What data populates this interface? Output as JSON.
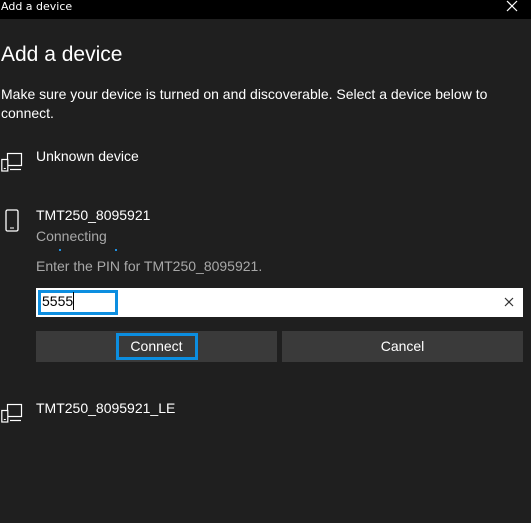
{
  "window": {
    "title": "Add a device",
    "close_icon": "close-icon"
  },
  "header": {
    "title": "Add a device",
    "description": "Make sure your device is turned on and discoverable. Select a device below to connect."
  },
  "devices": [
    {
      "name": "Unknown device",
      "icon": "computer-device-icon"
    },
    {
      "name": "TMT250_8095921",
      "icon": "phone-device-icon",
      "status": "Connecting"
    },
    {
      "name": "TMT250_8095921_LE",
      "icon": "computer-device-icon"
    }
  ],
  "pin": {
    "prompt": "Enter the PIN for TMT250_8095921.",
    "value": "5555",
    "clear_icon": "clear-icon"
  },
  "buttons": {
    "connect": "Connect",
    "cancel": "Cancel"
  },
  "colors": {
    "background": "#1f1f1f",
    "titlebar": "#000000",
    "accent": "#0c8ee0",
    "button": "#3a3a3a",
    "secondary_text": "#a8a8a8"
  }
}
